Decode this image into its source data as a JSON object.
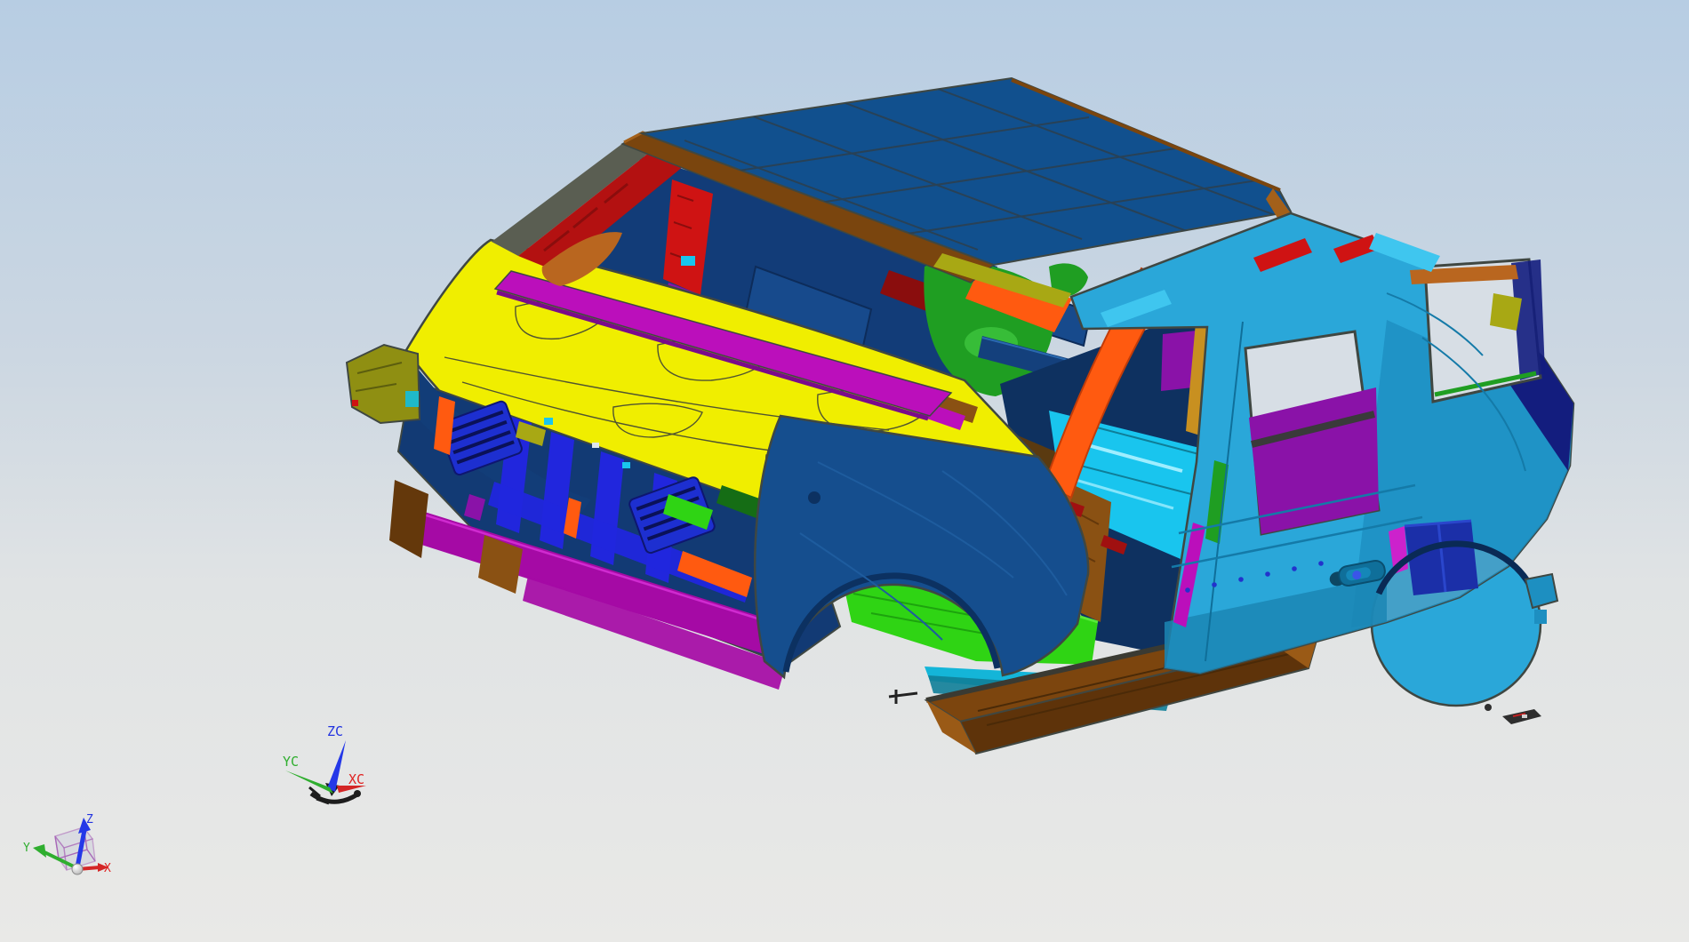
{
  "wcs_triad": {
    "z_label": "ZC",
    "y_label": "YC",
    "x_label": "XC"
  },
  "view_triad": {
    "z_label": "Z",
    "y_label": "Y",
    "x_label": "X"
  },
  "colors": {
    "bg_top": "#b7cde3",
    "bg_mid": "#ccd7e2",
    "bg_low": "#e0e3e4",
    "bg_bottom": "#e9e9e7",
    "outline": "#3f4742",
    "hood_yellow": "#f0ee00",
    "hood_line": "#3f4436",
    "roof_blue": "#11508e",
    "roof_line": "#2c4050",
    "rail_brown": "#7a450e",
    "rail_brown_hi": "#a3601a",
    "body_cyan": "#2aa7d9",
    "body_teal": "#1d8fc1",
    "body_hi": "#3fc6ef",
    "window_navy": "#131d7e",
    "arch_navy": "#1b2fa8",
    "arch_navy_hi": "#2a46cc",
    "fender_navy": "#154e8e",
    "frame_navy": "#123a74",
    "interior_navy": "#123c78",
    "cabin_navy": "#0e3160",
    "pillar_red": "#b31111",
    "interior_red": "#cf1313",
    "dark_red": "#8a0d0d",
    "pillar_copper": "#b9661f",
    "cowl_magenta": "#bb0fbb",
    "bumper_magenta": "#a50aa5",
    "interior_purple": "#8a12a8",
    "grille_blue": "#2126dd",
    "floor_green": "#2fd414",
    "interior_green": "#1f9e22",
    "dark_green": "#156d15",
    "floor_cyan": "#19c5ee",
    "floor_brown": "#8a5113",
    "floor_brown_dark": "#64380b",
    "rocker_brown": "#7c450e",
    "rocker_face": "#5e330a",
    "rocker_lip": "#3a3a32",
    "accent_orange": "#ff5a10",
    "header_olive": "#a8a814",
    "olive_tip": "#8f8f12",
    "gold_trim": "#c89020",
    "window_bg": "#d7dee5",
    "axis_red": "#d42626",
    "axis_green": "#2fae2f",
    "axis_blue": "#2438e8",
    "label_blue": "#2233e0",
    "label_green": "#2fae2f",
    "label_red": "#e02222",
    "cube_purple": "#a868b8",
    "widget_black": "#1d1d1d",
    "debris_dark": "#2e2e2e"
  }
}
